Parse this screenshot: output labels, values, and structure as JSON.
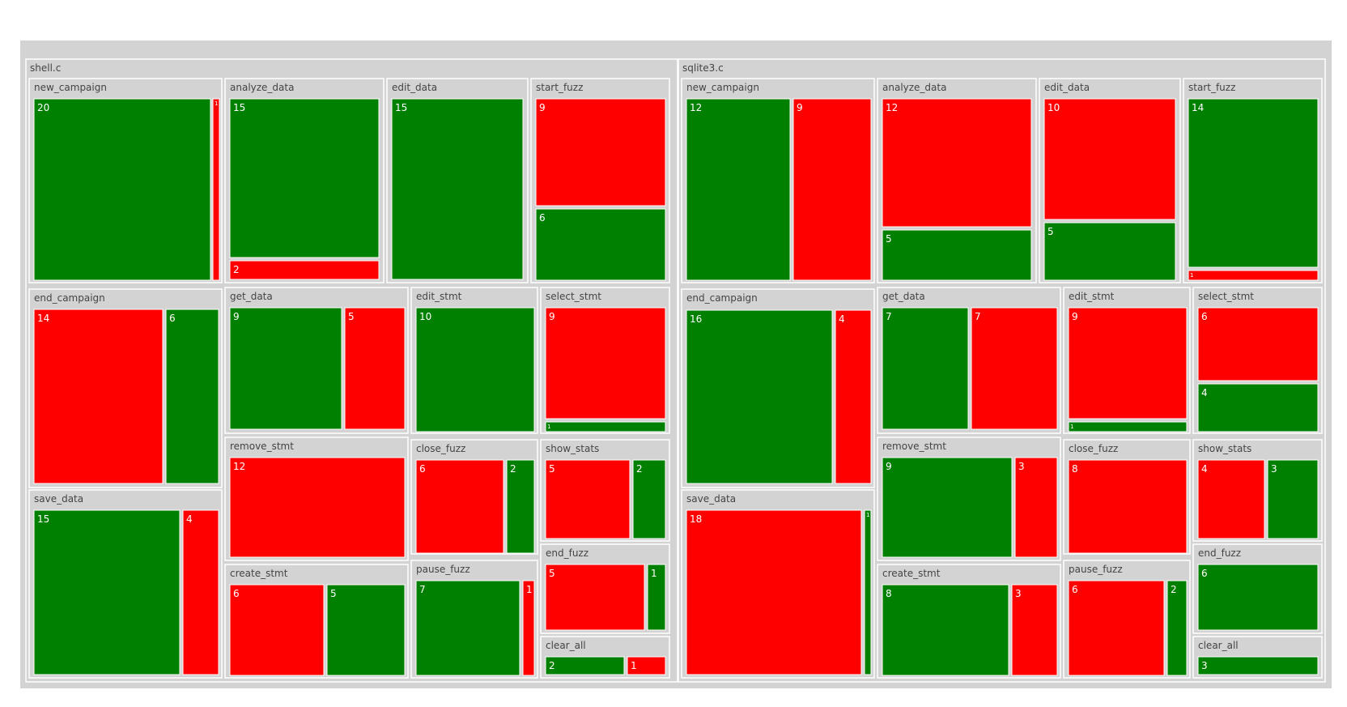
{
  "colors": {
    "background": "#d3d3d3",
    "cell_border": "#ffffff",
    "pass": "#008000",
    "fail": "#ff0000",
    "label_text": "#444444",
    "value_text": "#ffffff"
  },
  "chart_data": {
    "type": "treemap",
    "title": "",
    "groups": [
      {
        "name": "shell.c",
        "functions": [
          {
            "name": "new_campaign",
            "cells": [
              {
                "status": "pass",
                "value": 20
              },
              {
                "status": "fail",
                "value": 1
              }
            ]
          },
          {
            "name": "analyze_data",
            "cells": [
              {
                "status": "pass",
                "value": 15
              },
              {
                "status": "fail",
                "value": 2
              }
            ]
          },
          {
            "name": "edit_data",
            "cells": [
              {
                "status": "pass",
                "value": 15
              }
            ]
          },
          {
            "name": "start_fuzz",
            "cells": [
              {
                "status": "fail",
                "value": 9
              },
              {
                "status": "pass",
                "value": 6
              }
            ]
          },
          {
            "name": "end_campaign",
            "cells": [
              {
                "status": "fail",
                "value": 14
              },
              {
                "status": "pass",
                "value": 6
              }
            ]
          },
          {
            "name": "get_data",
            "cells": [
              {
                "status": "pass",
                "value": 9
              },
              {
                "status": "fail",
                "value": 5
              }
            ]
          },
          {
            "name": "edit_stmt",
            "cells": [
              {
                "status": "pass",
                "value": 10
              }
            ]
          },
          {
            "name": "select_stmt",
            "cells": [
              {
                "status": "fail",
                "value": 9
              },
              {
                "status": "pass",
                "value": 1
              }
            ]
          },
          {
            "name": "save_data",
            "cells": [
              {
                "status": "pass",
                "value": 15
              },
              {
                "status": "fail",
                "value": 4
              }
            ]
          },
          {
            "name": "remove_stmt",
            "cells": [
              {
                "status": "fail",
                "value": 12
              }
            ]
          },
          {
            "name": "close_fuzz",
            "cells": [
              {
                "status": "fail",
                "value": 6
              },
              {
                "status": "pass",
                "value": 2
              }
            ]
          },
          {
            "name": "show_stats",
            "cells": [
              {
                "status": "fail",
                "value": 5
              },
              {
                "status": "pass",
                "value": 2
              }
            ]
          },
          {
            "name": "create_stmt",
            "cells": [
              {
                "status": "fail",
                "value": 6
              },
              {
                "status": "pass",
                "value": 5
              }
            ]
          },
          {
            "name": "pause_fuzz",
            "cells": [
              {
                "status": "pass",
                "value": 7
              },
              {
                "status": "fail",
                "value": 1
              }
            ]
          },
          {
            "name": "end_fuzz",
            "cells": [
              {
                "status": "fail",
                "value": 5
              },
              {
                "status": "pass",
                "value": 1
              }
            ]
          },
          {
            "name": "clear_all",
            "cells": [
              {
                "status": "pass",
                "value": 2
              },
              {
                "status": "fail",
                "value": 1
              }
            ]
          }
        ]
      },
      {
        "name": "sqlite3.c",
        "functions": [
          {
            "name": "new_campaign",
            "cells": [
              {
                "status": "pass",
                "value": 12
              },
              {
                "status": "fail",
                "value": 9
              }
            ]
          },
          {
            "name": "analyze_data",
            "cells": [
              {
                "status": "fail",
                "value": 12
              },
              {
                "status": "pass",
                "value": 5
              }
            ]
          },
          {
            "name": "edit_data",
            "cells": [
              {
                "status": "fail",
                "value": 10
              },
              {
                "status": "pass",
                "value": 5
              }
            ]
          },
          {
            "name": "start_fuzz",
            "cells": [
              {
                "status": "pass",
                "value": 14
              },
              {
                "status": "fail",
                "value": 1
              }
            ]
          },
          {
            "name": "end_campaign",
            "cells": [
              {
                "status": "pass",
                "value": 16
              },
              {
                "status": "fail",
                "value": 4
              }
            ]
          },
          {
            "name": "get_data",
            "cells": [
              {
                "status": "pass",
                "value": 7
              },
              {
                "status": "fail",
                "value": 7
              }
            ]
          },
          {
            "name": "edit_stmt",
            "cells": [
              {
                "status": "fail",
                "value": 9
              },
              {
                "status": "pass",
                "value": 1
              }
            ]
          },
          {
            "name": "select_stmt",
            "cells": [
              {
                "status": "fail",
                "value": 6
              },
              {
                "status": "pass",
                "value": 4
              }
            ]
          },
          {
            "name": "save_data",
            "cells": [
              {
                "status": "fail",
                "value": 18
              },
              {
                "status": "pass",
                "value": 1
              }
            ]
          },
          {
            "name": "remove_stmt",
            "cells": [
              {
                "status": "pass",
                "value": 9
              },
              {
                "status": "fail",
                "value": 3
              }
            ]
          },
          {
            "name": "close_fuzz",
            "cells": [
              {
                "status": "fail",
                "value": 8
              }
            ]
          },
          {
            "name": "show_stats",
            "cells": [
              {
                "status": "fail",
                "value": 4
              },
              {
                "status": "pass",
                "value": 3
              }
            ]
          },
          {
            "name": "create_stmt",
            "cells": [
              {
                "status": "pass",
                "value": 8
              },
              {
                "status": "fail",
                "value": 3
              }
            ]
          },
          {
            "name": "pause_fuzz",
            "cells": [
              {
                "status": "fail",
                "value": 6
              },
              {
                "status": "pass",
                "value": 2
              }
            ]
          },
          {
            "name": "end_fuzz",
            "cells": [
              {
                "status": "pass",
                "value": 6
              }
            ]
          },
          {
            "name": "clear_all",
            "cells": [
              {
                "status": "pass",
                "value": 3
              }
            ]
          }
        ]
      }
    ]
  }
}
